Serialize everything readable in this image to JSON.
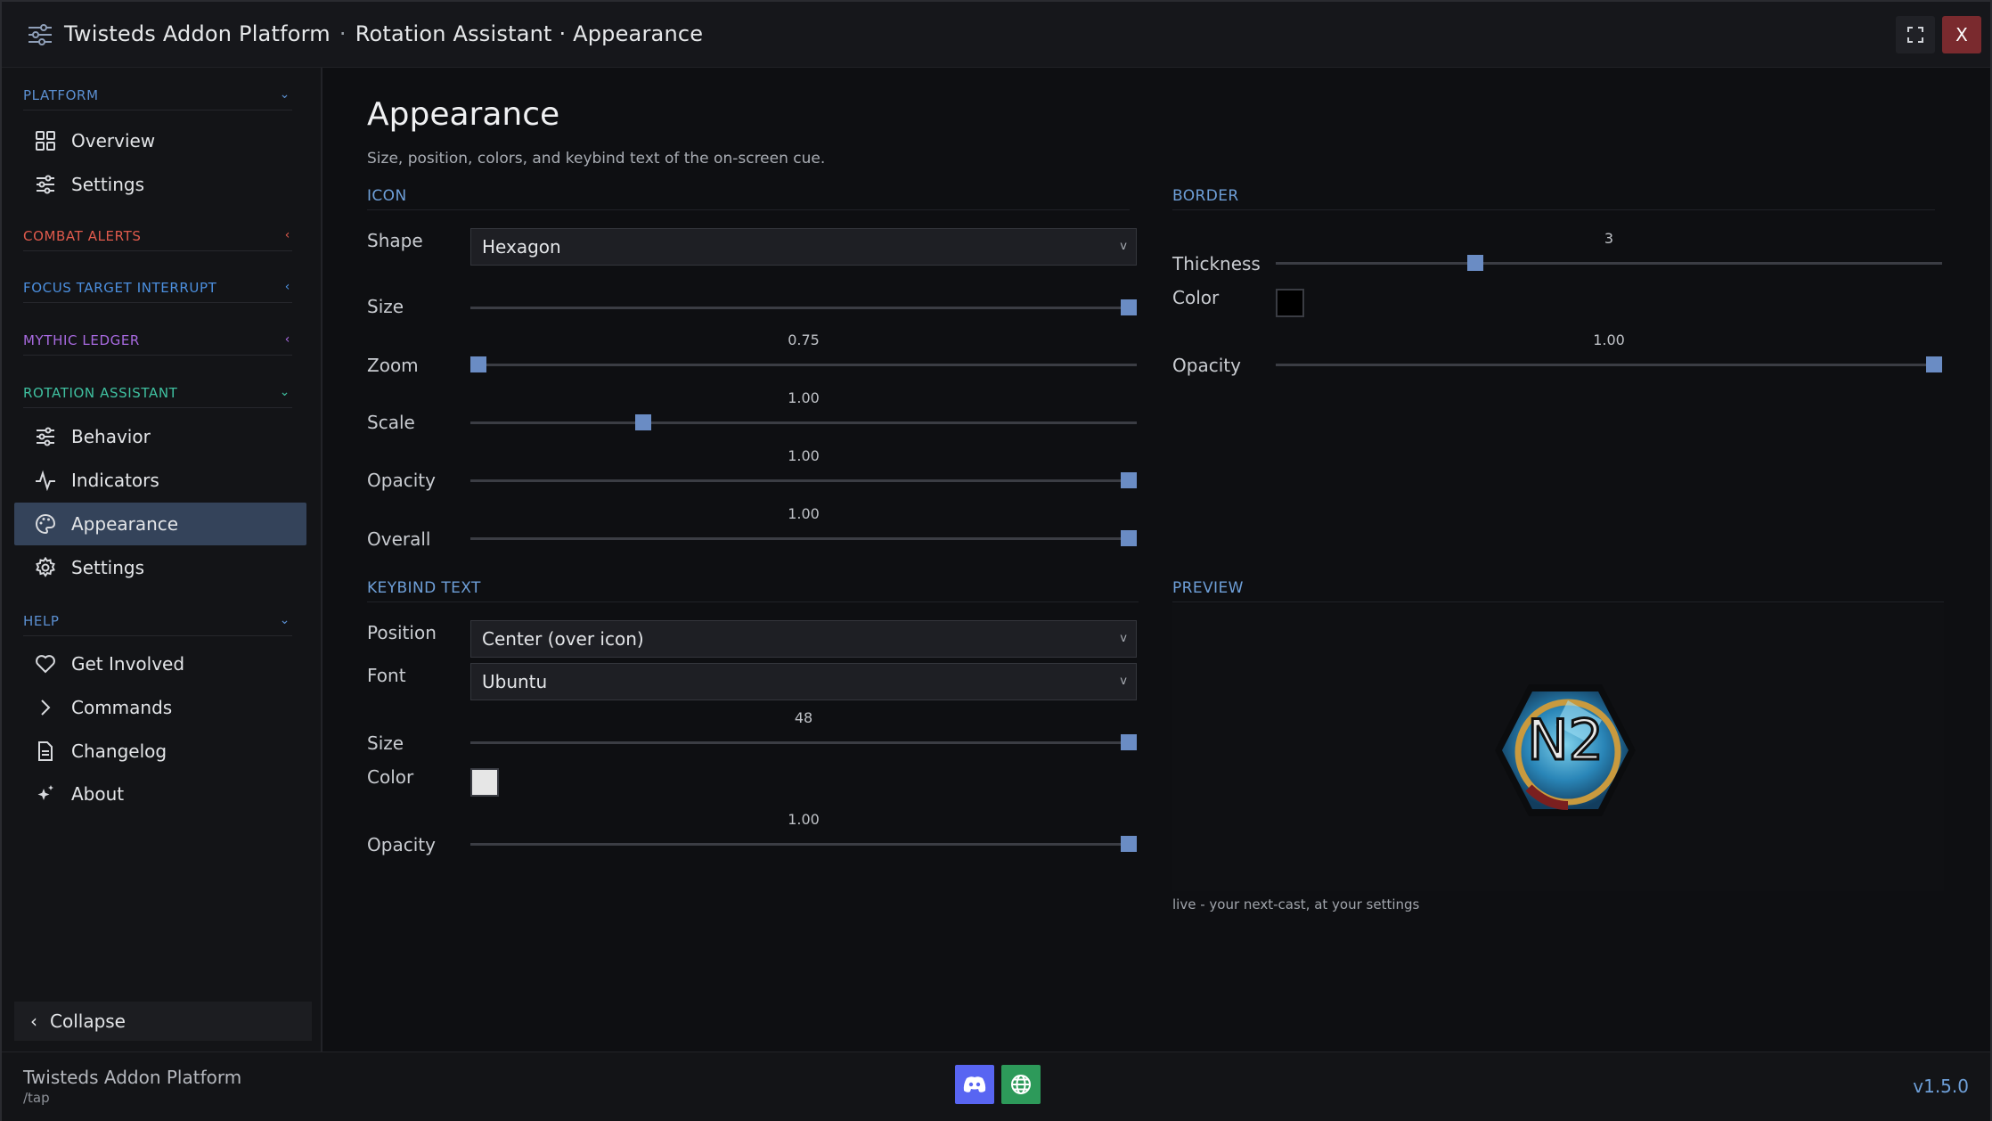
{
  "window": {
    "app_name": "Twisteds Addon Platform",
    "separator": "·",
    "breadcrumb": "Rotation Assistant · Appearance",
    "close_label": "X"
  },
  "sidebar": {
    "sections": [
      {
        "label": "PLATFORM",
        "color": "#5b8fd1",
        "chevron": "⌄"
      },
      {
        "label": "COMBAT ALERTS",
        "color": "#e05a4c",
        "chevron": "‹"
      },
      {
        "label": "FOCUS TARGET INTERRUPT",
        "color": "#4c90e0",
        "chevron": "‹"
      },
      {
        "label": "MYTHIC LEDGER",
        "color": "#a86ae0",
        "chevron": "‹"
      },
      {
        "label": "ROTATION ASSISTANT",
        "color": "#3fc0a0",
        "chevron": "⌄"
      },
      {
        "label": "HELP",
        "color": "#5b8fd1",
        "chevron": "⌄"
      }
    ],
    "items": {
      "overview": "Overview",
      "platform_settings": "Settings",
      "behavior": "Behavior",
      "indicators": "Indicators",
      "appearance": "Appearance",
      "ra_settings": "Settings",
      "get_involved": "Get Involved",
      "commands": "Commands",
      "changelog": "Changelog",
      "about": "About"
    },
    "collapse_label": "Collapse",
    "collapse_chevron": "‹"
  },
  "page": {
    "title": "Appearance",
    "subtitle": "Size, position, colors, and keybind text of the on-screen cue."
  },
  "icon_group": {
    "heading": "ICON",
    "shape_label": "Shape",
    "shape_value": "Hexagon",
    "size_label": "Size",
    "size_fraction": 1.0,
    "zoom_label": "Zoom",
    "zoom_value": "0.75",
    "zoom_fraction": 0.0,
    "scale_label": "Scale",
    "scale_value": "1.00",
    "scale_fraction": 0.26,
    "opacity_label": "Opacity",
    "opacity_value": "1.00",
    "opacity_fraction": 1.0,
    "overall_label": "Overall",
    "overall_value": "1.00",
    "overall_fraction": 1.0
  },
  "border_group": {
    "heading": "BORDER",
    "thickness_label": "Thickness",
    "thickness_value": "3",
    "thickness_fraction": 0.3,
    "color_label": "Color",
    "color_hex": "#000000",
    "opacity_label": "Opacity",
    "opacity_value": "1.00",
    "opacity_fraction": 1.0
  },
  "keybind_group": {
    "heading": "KEYBIND TEXT",
    "position_label": "Position",
    "position_value": "Center (over icon)",
    "font_label": "Font",
    "font_value": "Ubuntu",
    "size_label": "Size",
    "size_value": "48",
    "size_fraction": 1.0,
    "color_label": "Color",
    "color_hex": "#e6e6e6",
    "opacity_label": "Opacity",
    "opacity_value": "1.00",
    "opacity_fraction": 1.0
  },
  "preview_group": {
    "heading": "PREVIEW",
    "keybind_text": "N2",
    "caption": "live - your next-cast, at your settings"
  },
  "footer": {
    "app_name": "Twisteds Addon Platform",
    "command": "/tap",
    "version": "v1.5.0"
  },
  "colors": {
    "accent": "#6a8cc4",
    "active_nav": "#34435a",
    "close": "#7a2a2e"
  },
  "caret": "v"
}
